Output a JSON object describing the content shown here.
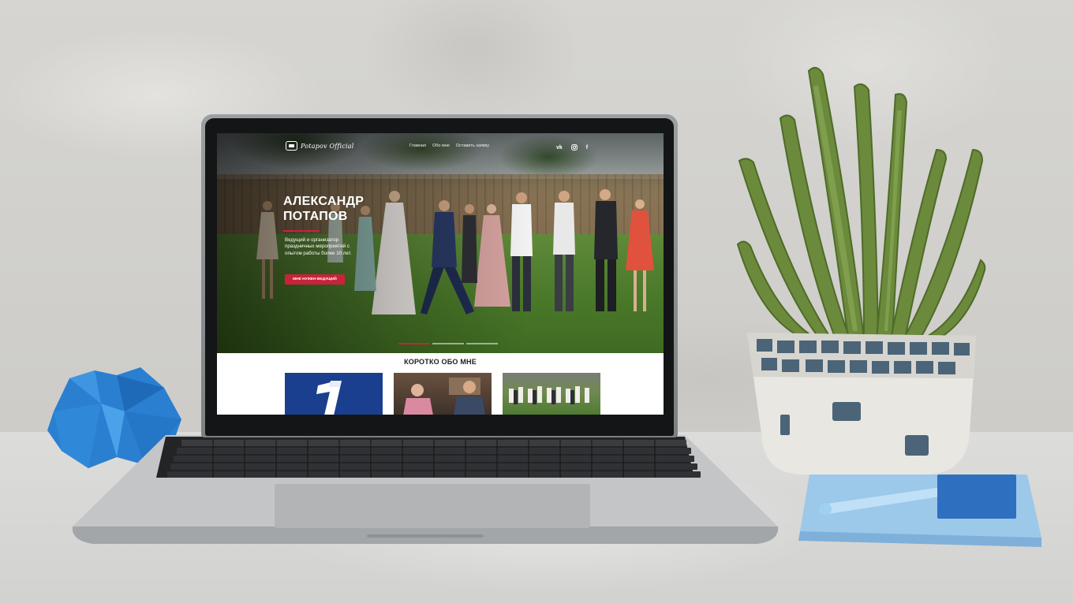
{
  "site": {
    "logo_text": "Potapov Official",
    "nav": [
      "Главная",
      "Обо мне",
      "Оставить заявку"
    ],
    "socials": {
      "vk": "vk",
      "instagram": "instagram-icon",
      "facebook": "f"
    },
    "hero": {
      "title_line1": "АЛЕКСАНДР",
      "title_line2": "ПОТАПОВ",
      "description": "Ведущий и организатор праздничных мероприятий с опытом работы более 10 лет.",
      "button": "МНЕ НУЖЕН ВЕДУЩИЙ"
    },
    "about": {
      "title": "КОРОТКО ОБО МНЕ"
    }
  },
  "colors": {
    "accent": "#c8233a",
    "channel_blue": "#1a3f8f"
  }
}
